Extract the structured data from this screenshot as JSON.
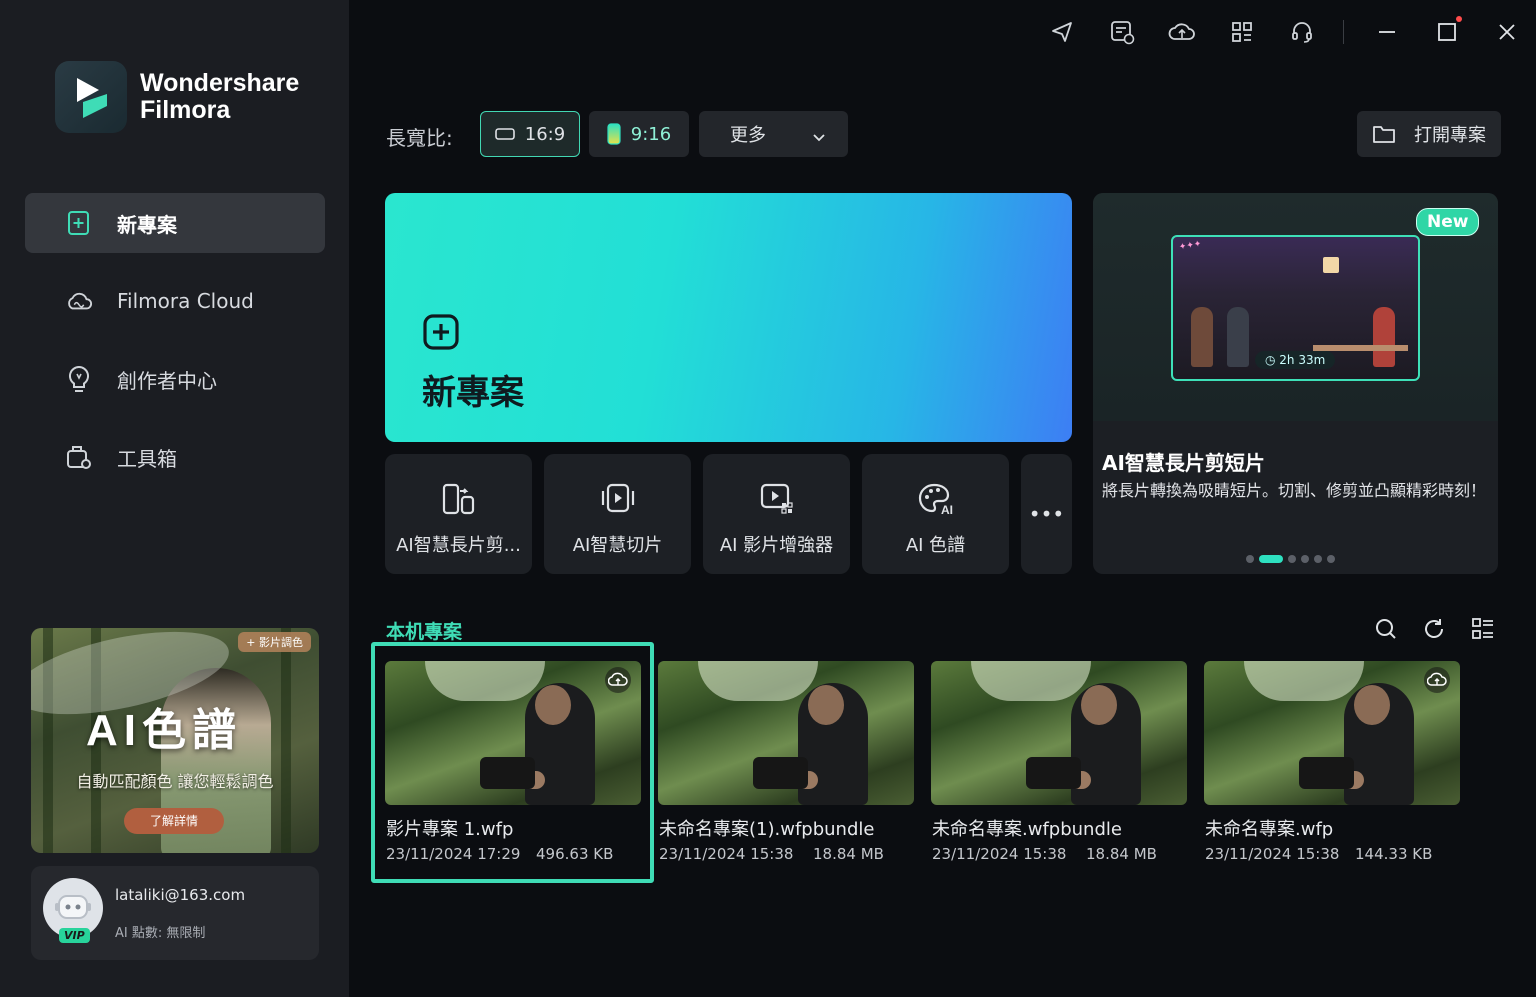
{
  "app": {
    "brand_line1": "Wondershare",
    "brand_line2": "Filmora"
  },
  "sidebar": {
    "items": [
      {
        "label": "新專案",
        "icon": "new-project-icon",
        "active": true
      },
      {
        "label": "Filmora Cloud",
        "icon": "cloud-icon",
        "active": false
      },
      {
        "label": "創作者中心",
        "icon": "bulb-icon",
        "active": false
      },
      {
        "label": "工具箱",
        "icon": "toolbox-icon",
        "active": false
      }
    ],
    "promo": {
      "tag": "+ 影片調色",
      "title": "AI色譜",
      "subtitle": "自動匹配顏色 讓您輕鬆調色",
      "button": "了解詳情"
    },
    "account": {
      "email": "lataliki@163.com",
      "ai_points": "AI 點數: 無限制",
      "badge": "VIP"
    }
  },
  "topbar": {
    "icons": [
      "send-feedback-icon",
      "task-list-icon",
      "cloud-sync-icon",
      "apps-grid-icon",
      "support-headset-icon"
    ],
    "window_controls": [
      "minimize-icon",
      "maximize-icon",
      "close-icon"
    ]
  },
  "aspect": {
    "label": "長寬比:",
    "option_169": "16:9",
    "option_916": "9:16",
    "more": "更多",
    "open_project": "打開專案",
    "selected": "16:9"
  },
  "hero": {
    "label": "新專案"
  },
  "tools": [
    {
      "label": "AI智慧長片剪...",
      "icon": "ai-long-to-short-icon"
    },
    {
      "label": "AI智慧切片",
      "icon": "ai-smart-cut-icon"
    },
    {
      "label": "AI 影片增強器",
      "icon": "ai-video-enhancer-icon"
    },
    {
      "label": "AI 色譜",
      "icon": "ai-palette-icon"
    }
  ],
  "tools_more": "•••",
  "feature": {
    "badge": "New",
    "duration": "2h 33m",
    "title": "AI智慧長片剪短片",
    "description": "將長片轉換為吸睛短片。切割、修剪並凸顯精彩時刻！",
    "slides": 6,
    "active_slide": 1
  },
  "local": {
    "title": "本机專案",
    "projects": [
      {
        "name": "影片專案 1.wfp",
        "date": "23/11/2024 17:29",
        "size": "496.63 KB",
        "cloud": true,
        "selected": true
      },
      {
        "name": "未命名專案(1).wfpbundle",
        "date": "23/11/2024 15:38",
        "size": "18.84 MB",
        "cloud": false,
        "selected": false
      },
      {
        "name": "未命名專案.wfpbundle",
        "date": "23/11/2024 15:38",
        "size": "18.84 MB",
        "cloud": false,
        "selected": false
      },
      {
        "name": "未命名專案.wfp",
        "date": "23/11/2024 15:38",
        "size": "144.33 KB",
        "cloud": true,
        "selected": false
      }
    ]
  },
  "colors": {
    "accent": "#3fdcb6",
    "sidebar_bg": "#1b1d22",
    "main_bg": "#0b0d11"
  }
}
